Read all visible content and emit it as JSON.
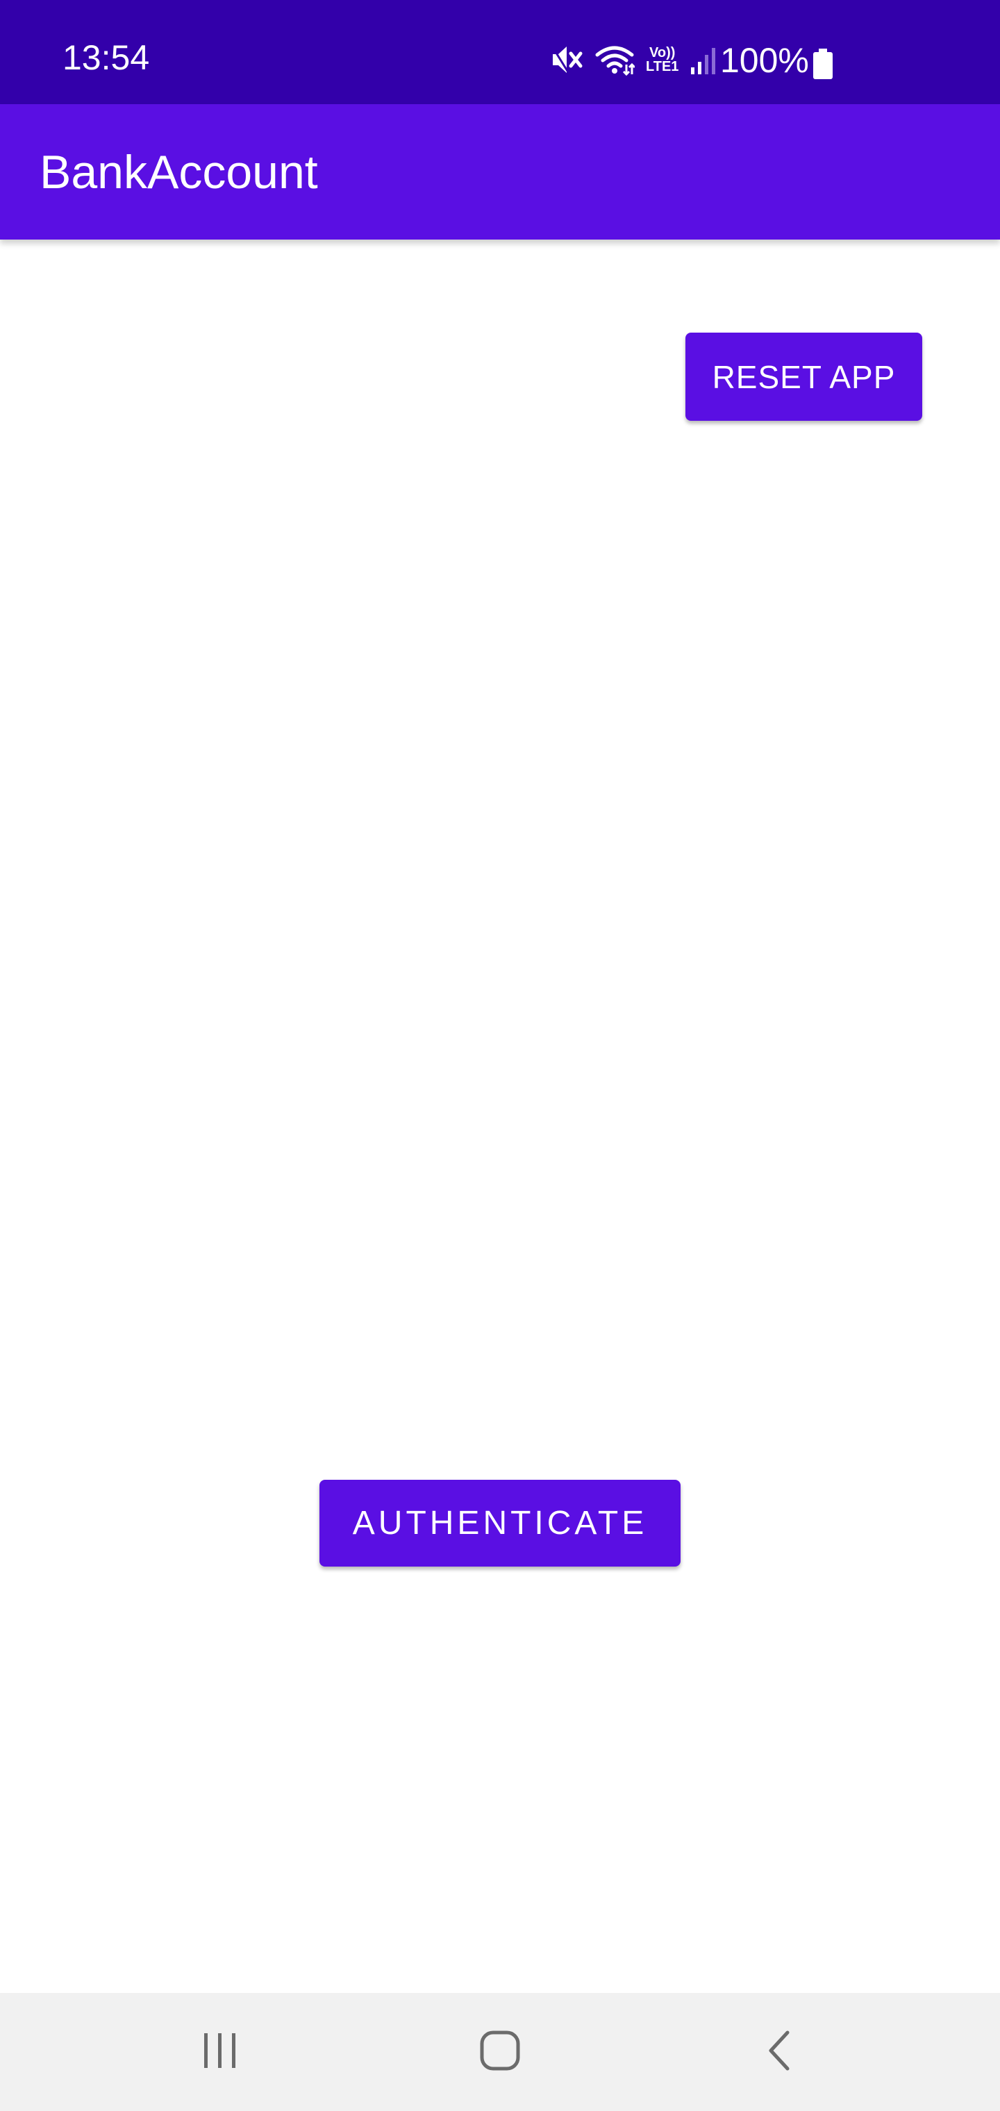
{
  "status_bar": {
    "time": "13:54",
    "battery_percent": "100%",
    "icons": [
      "mute-icon",
      "wifi-icon",
      "volte-lte-icon",
      "signal-icon",
      "battery-icon"
    ],
    "volte_text_top": "Vo))",
    "volte_text_bottom": "LTE1"
  },
  "app_bar": {
    "title": "BankAccount"
  },
  "main": {
    "reset_label": "RESET APP",
    "authenticate_label": "AUTHENTICATE"
  },
  "nav_bar": {
    "icons": [
      "recents-icon",
      "home-icon",
      "back-icon"
    ]
  },
  "colors": {
    "status_bar": "#3300aa",
    "primary": "#5a0fe3",
    "background": "#ffffff",
    "nav_bar": "#f1f1f1",
    "nav_icon": "#6b6b6b"
  }
}
